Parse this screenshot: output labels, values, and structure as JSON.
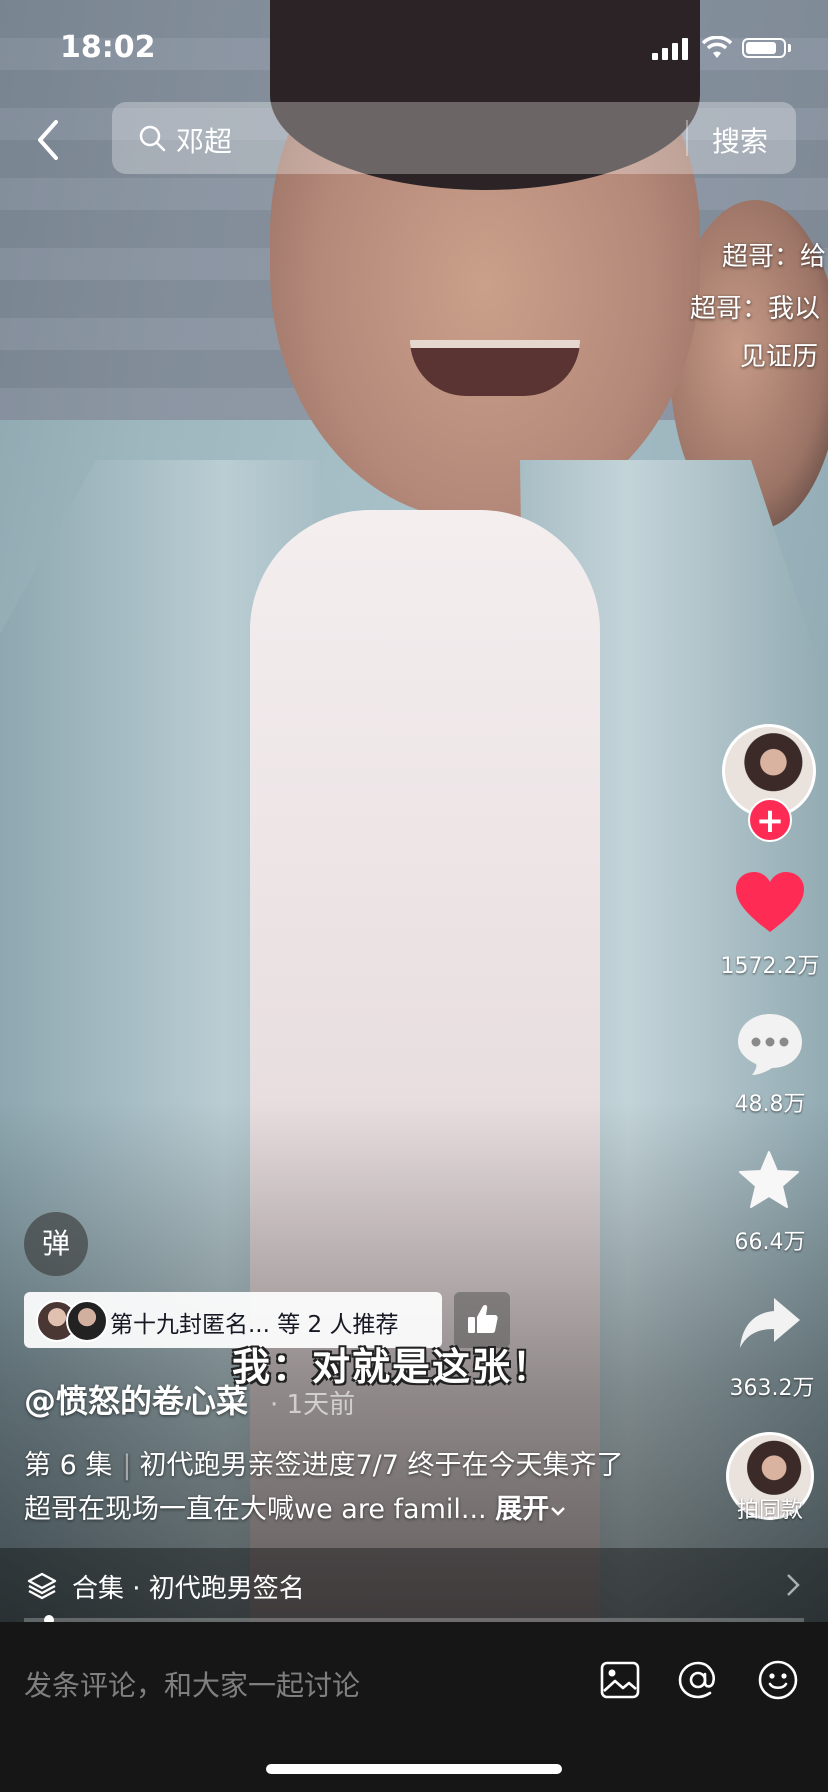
{
  "status_bar": {
    "time": "18:02"
  },
  "search": {
    "query": "邓超",
    "button": "搜索"
  },
  "danmaku": [
    "超哥：给",
    "超哥：我以",
    "见证历"
  ],
  "rail": {
    "likes": "1572.2万",
    "comments": "48.8万",
    "favorites": "66.4万",
    "shares": "363.2万",
    "same_style_label": "拍同款"
  },
  "danmaku_toggle": "弹",
  "recommend": {
    "text": "第十九封匿名... 等 2 人推荐"
  },
  "subtitle": "我：对就是这张！",
  "post": {
    "author": "@愤怒的卷心菜",
    "time": "· 1天前",
    "episode": "第 6 集",
    "description": "初代跑男亲签进度7/7 终于在今天集齐了 超哥在现场一直在大喊we are famil...",
    "expand": "展开"
  },
  "collection": {
    "label": "合集 · 初代跑男签名"
  },
  "comment_bar": {
    "placeholder": "发条评论，和大家一起讨论"
  },
  "colors": {
    "accent": "#fe2c55",
    "like": "#fe2c55",
    "bar_bg": "#161616"
  },
  "icons": [
    "back-icon",
    "search-icon",
    "like-icon",
    "comment-icon",
    "star-icon",
    "share-icon",
    "collection-icon",
    "image-icon",
    "at-icon",
    "emoji-icon"
  ]
}
